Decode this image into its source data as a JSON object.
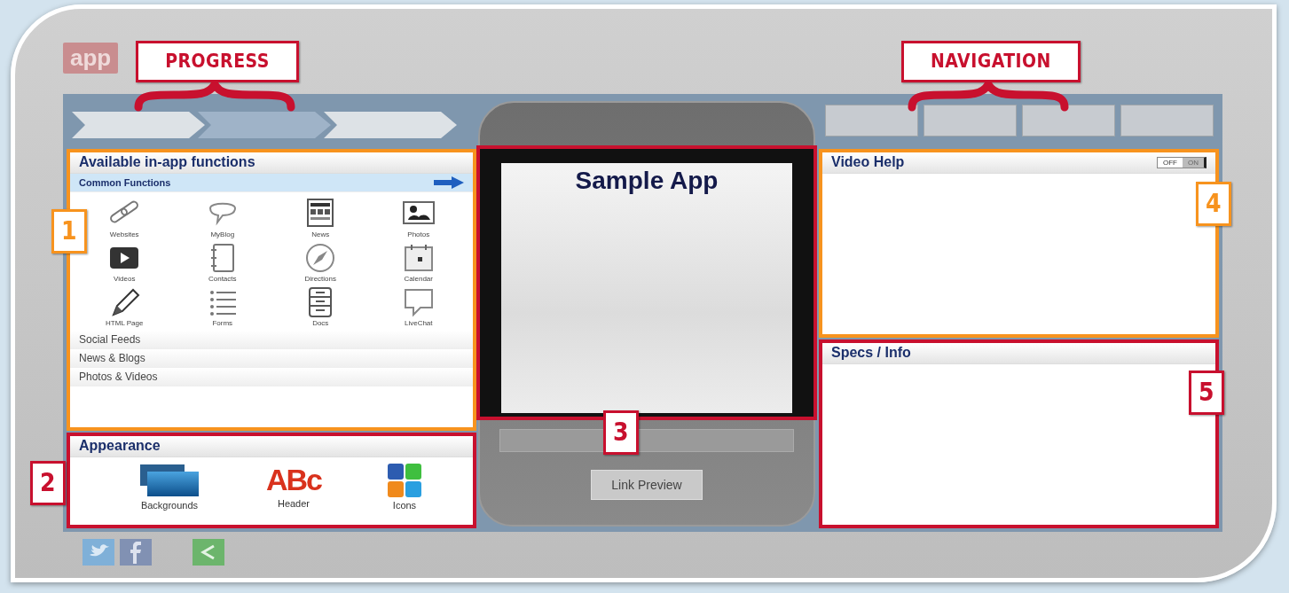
{
  "logo": {
    "text": "app"
  },
  "callouts": [
    {
      "label": "PROGRESS",
      "kind": "banner",
      "color": "#c8102e"
    },
    {
      "label": "NAVIGATION",
      "kind": "banner",
      "color": "#c8102e"
    },
    {
      "label": "1",
      "kind": "number",
      "color": "#f7931e"
    },
    {
      "label": "2",
      "kind": "number",
      "color": "#c8102e"
    },
    {
      "label": "3",
      "kind": "number",
      "color": "#c8102e"
    },
    {
      "label": "4",
      "kind": "number",
      "color": "#f7931e"
    },
    {
      "label": "5",
      "kind": "number",
      "color": "#c8102e"
    }
  ],
  "progress_steps": [
    {
      "selected": false
    },
    {
      "selected": true
    },
    {
      "selected": false
    }
  ],
  "nav_buttons": [
    {
      "disabled": true
    },
    {
      "disabled": true
    },
    {
      "disabled": true
    },
    {
      "disabled": true
    }
  ],
  "functions_panel": {
    "title": "Available in-app functions",
    "color": "#f7931e",
    "categories": [
      {
        "label": "Common Functions",
        "expanded": true,
        "items": [
          {
            "label": "Websites",
            "kind": "link"
          },
          {
            "label": "MyBlog",
            "kind": "bubble"
          },
          {
            "label": "News",
            "kind": "news"
          },
          {
            "label": "Photos",
            "kind": "photo"
          },
          {
            "label": "Videos",
            "kind": "video"
          },
          {
            "label": "Contacts",
            "kind": "contacts"
          },
          {
            "label": "Directions",
            "kind": "compass"
          },
          {
            "label": "Calendar",
            "kind": "calendar"
          },
          {
            "label": "HTML Page",
            "kind": "pencil"
          },
          {
            "label": "Forms",
            "kind": "list"
          },
          {
            "label": "Docs",
            "kind": "docs"
          },
          {
            "label": "LiveChat",
            "kind": "chat"
          }
        ]
      },
      {
        "label": "Social Feeds",
        "expanded": false
      },
      {
        "label": "News & Blogs",
        "expanded": false
      },
      {
        "label": "Photos & Videos",
        "expanded": false
      }
    ]
  },
  "appearance_panel": {
    "title": "Appearance",
    "color": "#c8102e",
    "items": [
      {
        "label": "Backgrounds",
        "kind": "backgrounds"
      },
      {
        "label": "Header",
        "kind": "letters",
        "glyph": "ABc"
      },
      {
        "label": "Icons",
        "kind": "social"
      }
    ]
  },
  "phone": {
    "title": "Sample App",
    "button": "Link Preview",
    "color": "#c8102e"
  },
  "video_help": {
    "title": "Video Help",
    "color": "#f7931e",
    "toggle": {
      "off_label": "OFF",
      "on_label": "ON",
      "on": false
    }
  },
  "specs": {
    "title": "Specs / Info",
    "color": "#c8102e"
  }
}
